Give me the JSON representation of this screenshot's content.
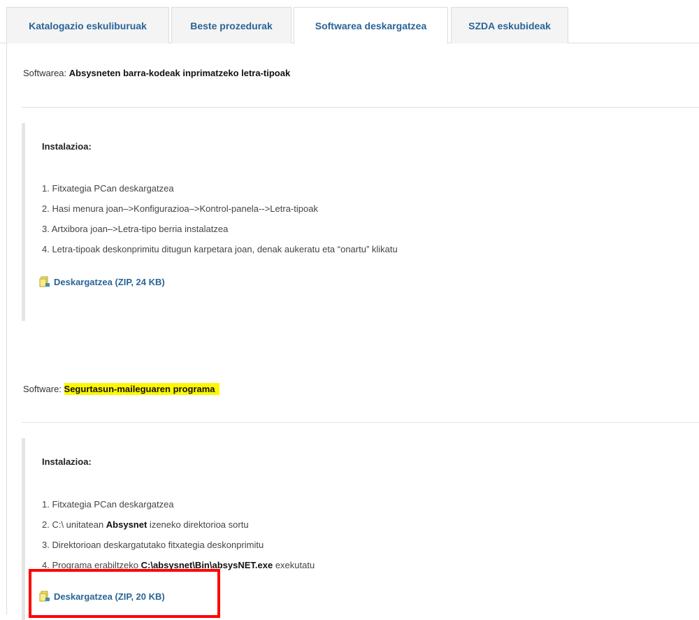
{
  "tabs": [
    {
      "label": "Katalogazio eskuliburuak"
    },
    {
      "label": "Beste prozedurak"
    },
    {
      "label": "Softwarea deskargatzea"
    },
    {
      "label": "SZDA eskubideak"
    }
  ],
  "software1": {
    "prefix": "Softwarea: ",
    "name": "Absysneten barra-kodeak inprimatzeko letra-tipoak",
    "install_title": "Instalazioa:",
    "steps": [
      "1. Fitxategia PCan deskargatzea",
      "2. Hasi menura joan–>Konfigurazioa–>Kontrol-panela-->Letra-tipoak",
      "3. Artxibora joan–>Letra-tipo berria instalatzea",
      "4. Letra-tipoak deskonprimitu ditugun karpetara joan, denak aukeratu eta “onartu” klikatu"
    ],
    "download_label": "Deskargatzea (ZIP, 24 KB)"
  },
  "software2": {
    "prefix": "Software: ",
    "name": "Segurtasun-maileguaren programa",
    "install_title": "Instalazioa:",
    "step1": "1. Fitxategia PCan deskargatzea",
    "step2_pre": "2. C:\\ unitatean ",
    "step2_bold": "Absysnet",
    "step2_post": " izeneko direktorioa sortu",
    "step3": "3. Direktorioan deskargatutako fitxategia deskonprimitu",
    "step4_pre": "4. Programa erabiltzeko ",
    "step4_bold": "C:\\absysnet\\Bin\\absysNET.exe",
    "step4_post": " exekutatu",
    "download_label": "Deskargatzea (ZIP, 20 KB)"
  },
  "colors": {
    "link": "#2a6496",
    "highlight": "#fff700",
    "annotation": "#ff0000"
  }
}
